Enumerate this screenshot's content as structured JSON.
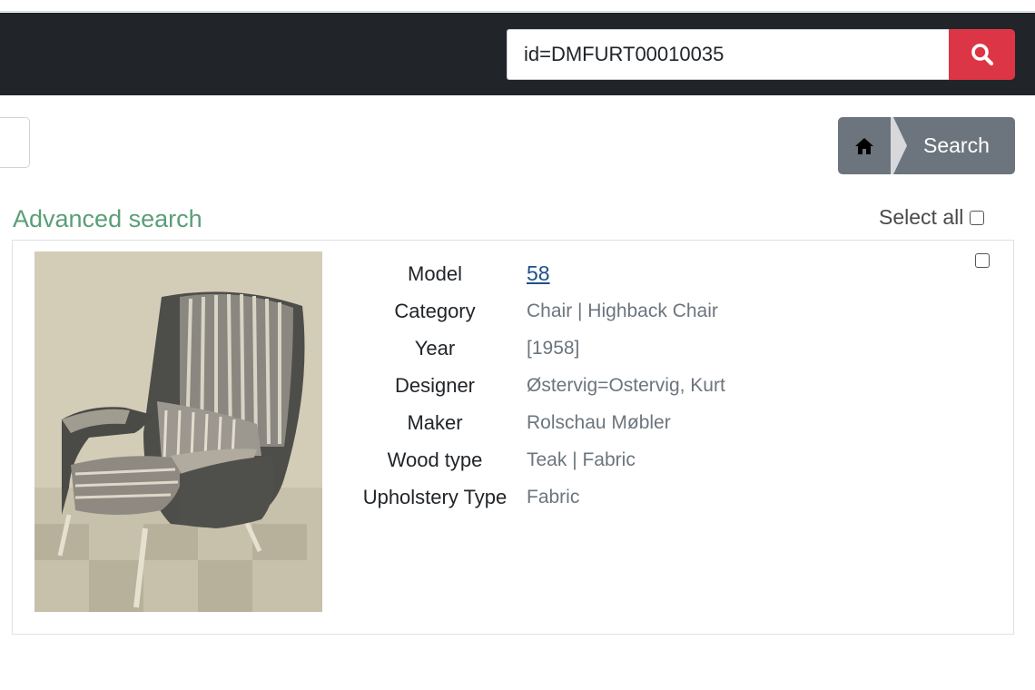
{
  "header": {
    "search_value": "id=DMFURT00010035",
    "search_button_icon": "search-icon",
    "bar_color": "#212529",
    "button_color": "#dc3545"
  },
  "breadcrumb": {
    "home_icon": "home-icon",
    "current": "Search"
  },
  "advanced_search_label": "Advanced search",
  "select_all_label": "Select all",
  "record": {
    "fields": [
      {
        "label": "Model",
        "value": "58",
        "link": true
      },
      {
        "label": "Category",
        "value": "Chair | Highback Chair"
      },
      {
        "label": "Year",
        "value": "[1958]"
      },
      {
        "label": "Designer",
        "value": "Østervig=Ostervig, Kurt"
      },
      {
        "label": "Maker",
        "value": "Rolschau Møbler"
      },
      {
        "label": "Wood type",
        "value": "Teak | Fabric"
      },
      {
        "label": "Upholstery Type",
        "value": "Fabric"
      }
    ]
  }
}
